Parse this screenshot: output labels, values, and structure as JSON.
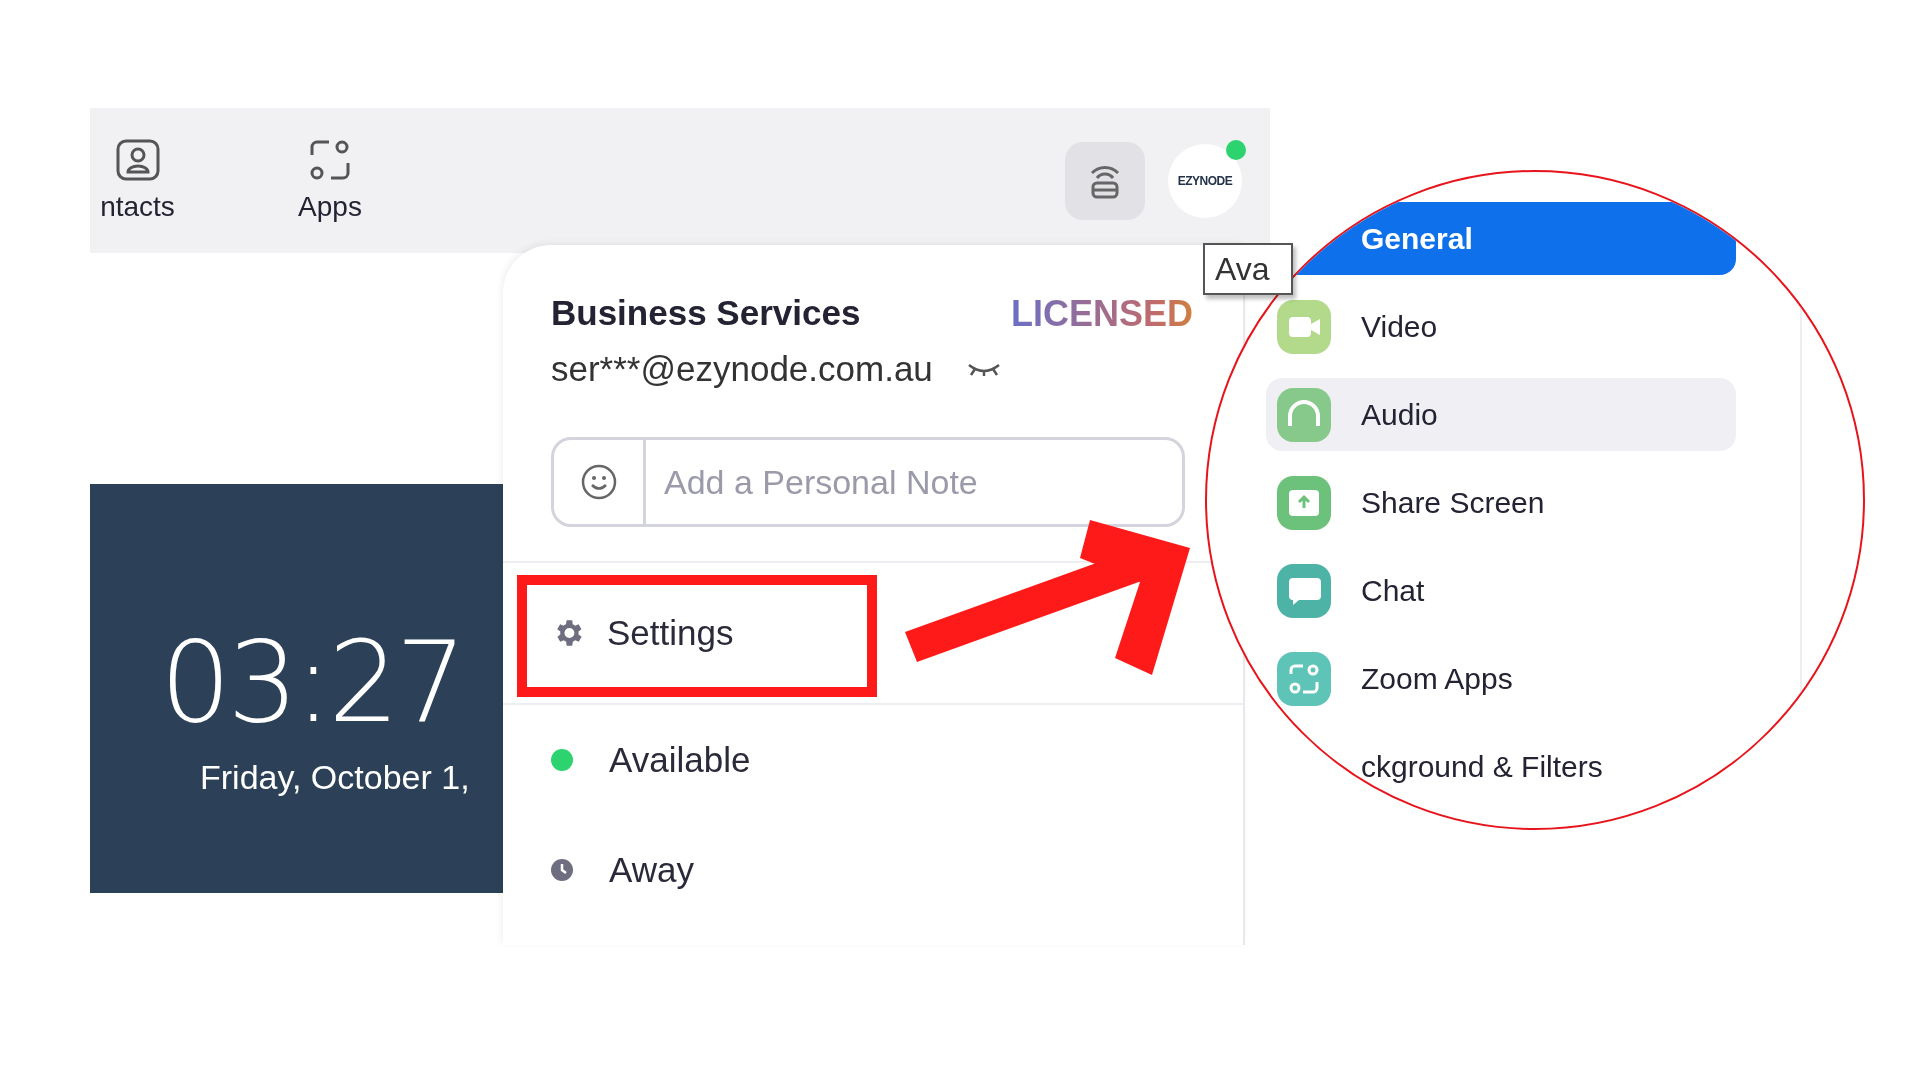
{
  "top_bar": {
    "tabs": [
      {
        "label": "ntacts",
        "kind": "contacts"
      },
      {
        "label": "Apps",
        "kind": "apps"
      }
    ],
    "avatar_text": "EZYNODE"
  },
  "lock_screen": {
    "time": "03:27",
    "date": "Friday, October 1,"
  },
  "tooltip": "Ava",
  "profile_menu": {
    "name": "Business Services",
    "badge": "LICENSED",
    "email": "ser***@ezynode.com.au",
    "note": {
      "placeholder": "Add a Personal Note"
    },
    "items": [
      {
        "label": "Settings",
        "kind": "settings"
      },
      {
        "label": "Available",
        "kind": "available"
      },
      {
        "label": "Away",
        "kind": "away"
      }
    ]
  },
  "settings_nav": [
    {
      "label": "General",
      "kind": "general",
      "selected": true,
      "highlighted": false
    },
    {
      "label": "Video",
      "kind": "video",
      "selected": false,
      "highlighted": false
    },
    {
      "label": "Audio",
      "kind": "audio",
      "selected": false,
      "highlighted": true
    },
    {
      "label": "Share Screen",
      "kind": "share",
      "selected": false,
      "highlighted": false
    },
    {
      "label": "Chat",
      "kind": "chat",
      "selected": false,
      "highlighted": false
    },
    {
      "label": "Zoom Apps",
      "kind": "apps",
      "selected": false,
      "highlighted": false
    },
    {
      "label": "ckground & Filters",
      "kind": "background",
      "selected": false,
      "highlighted": false
    }
  ]
}
